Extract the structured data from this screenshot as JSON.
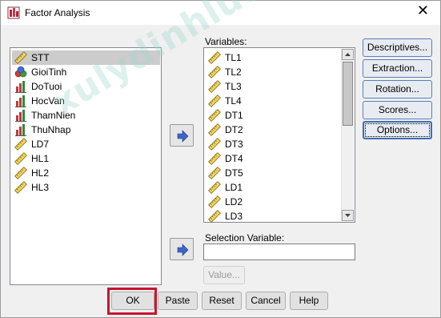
{
  "window": {
    "title": "Factor Analysis",
    "close_glyph": "✕"
  },
  "source_list": {
    "items": [
      {
        "label": "STT",
        "icon": "scale-ruler-icon",
        "selected": true
      },
      {
        "label": "GioiTinh",
        "icon": "nominal-icon",
        "selected": false
      },
      {
        "label": "DoTuoi",
        "icon": "ordinal-icon",
        "selected": false
      },
      {
        "label": "HocVan",
        "icon": "ordinal-icon",
        "selected": false
      },
      {
        "label": "ThamNien",
        "icon": "ordinal-icon",
        "selected": false
      },
      {
        "label": "ThuNhap",
        "icon": "ordinal-icon",
        "selected": false
      },
      {
        "label": "LD7",
        "icon": "scale-ruler-icon",
        "selected": false
      },
      {
        "label": "HL1",
        "icon": "scale-ruler-icon",
        "selected": false
      },
      {
        "label": "HL2",
        "icon": "scale-ruler-icon",
        "selected": false
      },
      {
        "label": "HL3",
        "icon": "scale-ruler-icon",
        "selected": false
      }
    ]
  },
  "variables": {
    "label": "Variables:",
    "items": [
      "TL1",
      "TL2",
      "TL3",
      "TL4",
      "DT1",
      "DT2",
      "DT3",
      "DT4",
      "DT5",
      "LD1",
      "LD2",
      "LD3"
    ]
  },
  "selection": {
    "label": "Selection Variable:",
    "value": "",
    "value_button": "Value..."
  },
  "right_buttons": {
    "descriptives": "Descriptives...",
    "extraction": "Extraction...",
    "rotation": "Rotation...",
    "scores": "Scores...",
    "options": "Options..."
  },
  "bottom_buttons": {
    "ok": "OK",
    "paste": "Paste",
    "reset": "Reset",
    "cancel": "Cancel",
    "help": "Help"
  },
  "watermark": "xulydinhluong.com",
  "colors": {
    "highlight_border": "#c8142d",
    "arrow_blue": "#3f64c8",
    "selected_row": "#cccccc"
  }
}
